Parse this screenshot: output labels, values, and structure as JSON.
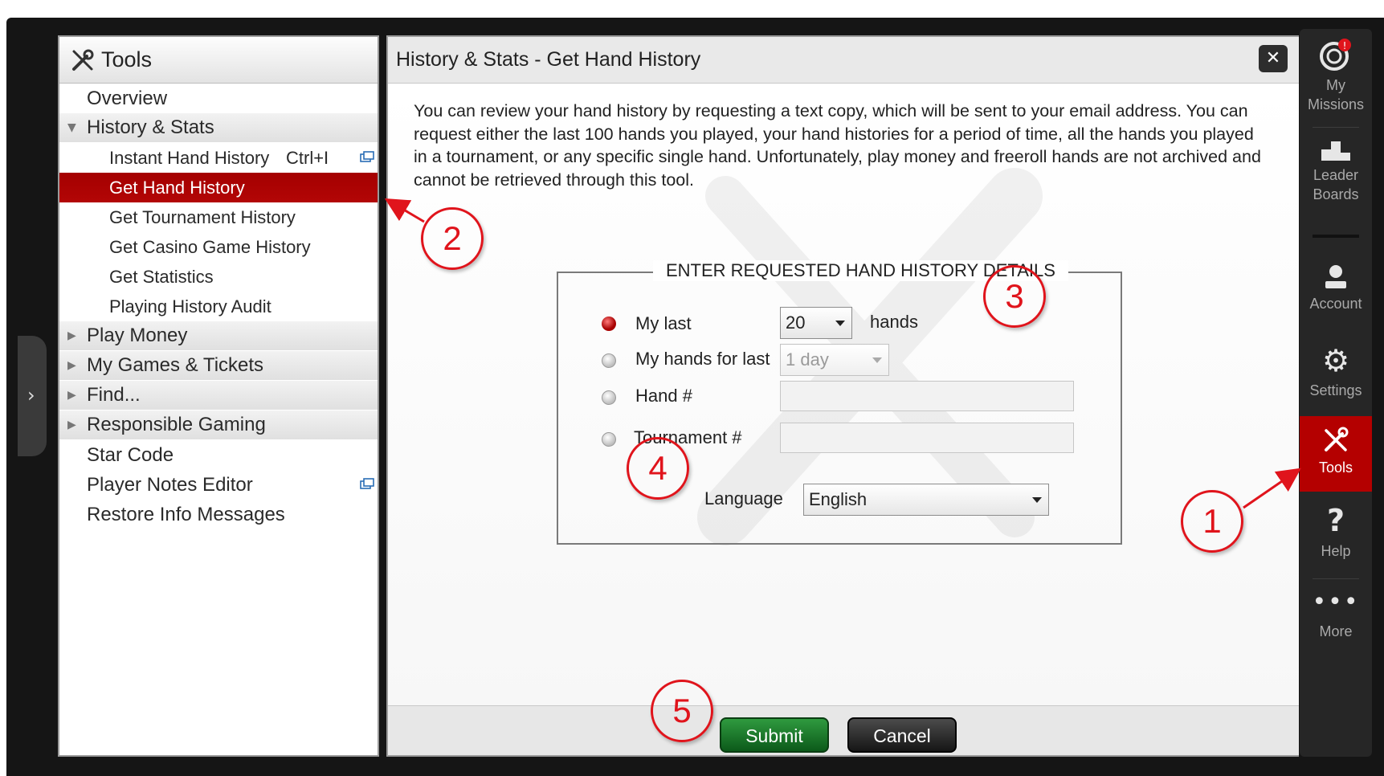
{
  "left_panel": {
    "title": "Tools",
    "items": [
      {
        "label": "Overview"
      },
      {
        "label": "History & Stats"
      },
      {
        "label": "Instant Hand History",
        "shortcut": "Ctrl+I"
      },
      {
        "label": "Get Hand History"
      },
      {
        "label": "Get Tournament History"
      },
      {
        "label": "Get Casino Game History"
      },
      {
        "label": "Get Statistics"
      },
      {
        "label": "Playing History Audit"
      },
      {
        "label": "Play Money"
      },
      {
        "label": "My Games & Tickets"
      },
      {
        "label": "Find..."
      },
      {
        "label": "Responsible Gaming"
      },
      {
        "label": "Star Code"
      },
      {
        "label": "Player Notes Editor"
      },
      {
        "label": "Restore Info Messages"
      }
    ]
  },
  "dialog": {
    "title": "History & Stats - Get Hand History",
    "intro": "You can review your hand history by requesting a text copy, which will be sent to your email address. You can request either the last 100 hands you played, your hand histories for a period of time, all the hands you played in a tournament, or any specific single hand. Unfortunately, play money and freeroll hands are not archived and cannot be retrieved through this tool.",
    "section_title": "ENTER REQUESTED HAND HISTORY DETAILS",
    "options": {
      "my_last": {
        "label": "My last",
        "value": "20",
        "suffix": "hands"
      },
      "hands_for_last": {
        "label": "My hands for last",
        "value": "1 day"
      },
      "hand_number": {
        "label": "Hand #",
        "value": ""
      },
      "tournament_number": {
        "label": "Tournament #",
        "value": ""
      }
    },
    "language": {
      "label": "Language",
      "value": "English"
    },
    "submit_label": "Submit",
    "cancel_label": "Cancel"
  },
  "right_sidebar": {
    "items": [
      {
        "label_1": "My",
        "label_2": "Missions",
        "icon": "target-icon"
      },
      {
        "label_1": "Leader",
        "label_2": "Boards",
        "icon": "podium-icon"
      },
      {
        "label_1": "Account",
        "icon": "user-icon"
      },
      {
        "label_1": "Settings",
        "icon": "gear-icon"
      },
      {
        "label_1": "Tools",
        "icon": "tools-icon"
      },
      {
        "label_1": "Help",
        "icon": "help-icon"
      },
      {
        "label_1": "More",
        "icon": "more-icon"
      }
    ],
    "badge": "!"
  },
  "callouts": [
    "1",
    "2",
    "3",
    "4",
    "5"
  ],
  "colors": {
    "active_red": "#b40000",
    "callout_red": "#e0141c",
    "submit_green": "#1e7a2c"
  }
}
